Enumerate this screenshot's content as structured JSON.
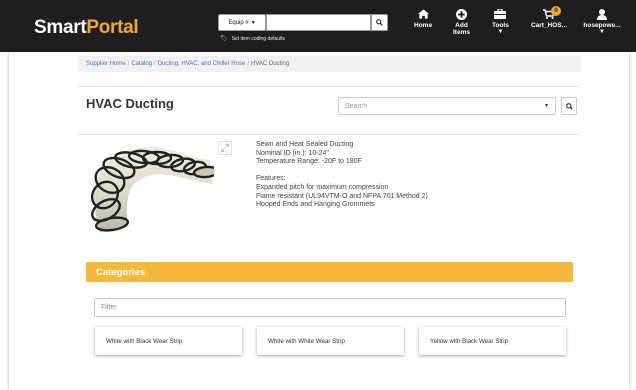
{
  "header": {
    "logo_smart": "Smart",
    "logo_p": "P",
    "logo_o": "o",
    "logo_rtal": "rtal",
    "equip_label": "Equip #",
    "search_value": "",
    "set_defaults": "Set item coding defaults",
    "nav": {
      "home": "Home",
      "add_items_1": "Add",
      "add_items_2": "Items",
      "tools": "Tools",
      "cart": "Cart_HOS...",
      "cart_count": "0",
      "user": "hosepowe..."
    }
  },
  "breadcrumb": {
    "items": [
      "Supplier Home",
      "Catalog",
      "Ducting, HVAC, and Chiller Hose",
      "HVAC Ducting"
    ],
    "sep": "/"
  },
  "page": {
    "title": "HVAC Ducting",
    "search_placeholder": "Search"
  },
  "product": {
    "description": [
      "Sewn and Heat Sealed Ducting",
      "Nominal ID (in.): 10-24\"",
      "Temperature Range: -20F to 180F",
      "",
      "Features:",
      "Expanded pitch for maximum compression",
      "Flame resistant (UL94VTM-O and NFPA 701 Method 2)",
      "Hooped Ends and Hanging Grommets"
    ]
  },
  "categories": {
    "header": "Categories",
    "filter_placeholder": "Filter",
    "items": [
      "White with Black Wear Strip",
      "White with White Wear Strip",
      "Yellow with Black Wear Strip"
    ]
  },
  "colors": {
    "header_bg": "#1e1e1e",
    "accent": "#f0a92c",
    "category_bar": "#f5b83c",
    "link": "#3a7bbf"
  }
}
